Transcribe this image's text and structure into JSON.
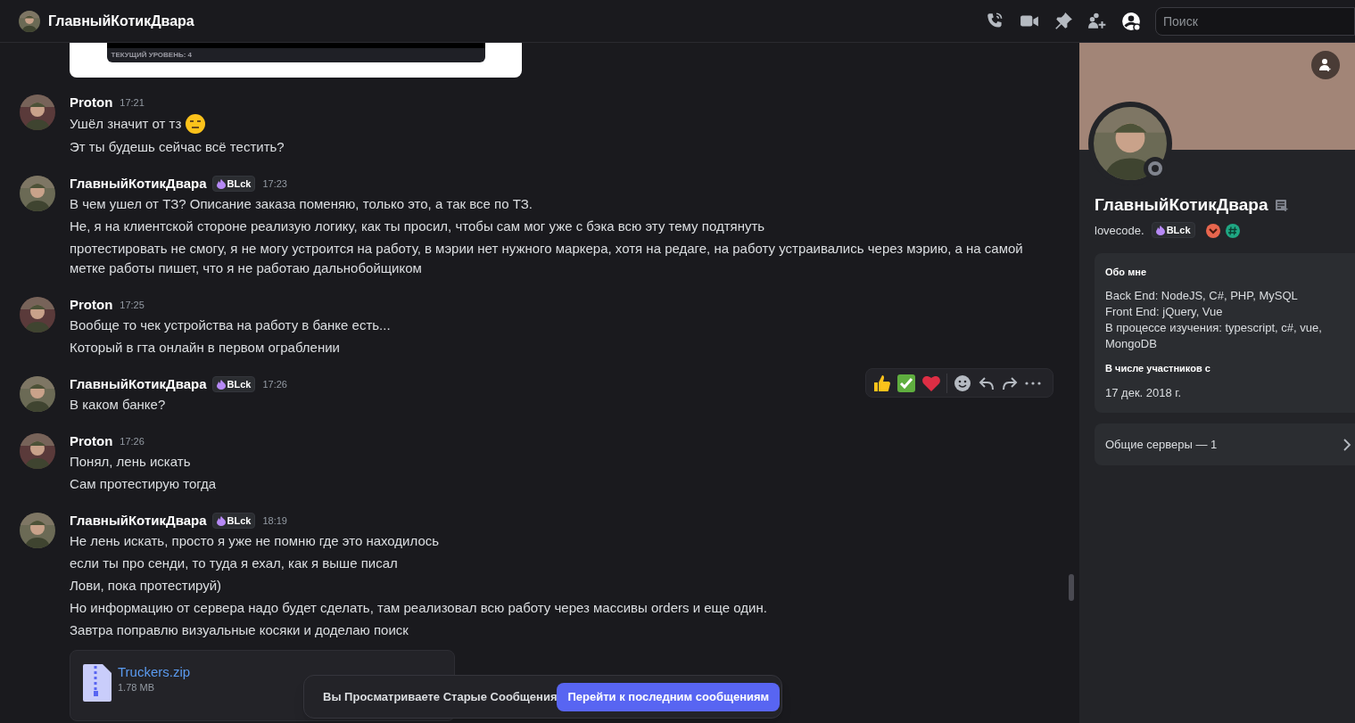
{
  "header": {
    "title": "ГлавныйКотикДвара",
    "toolbar": [
      {
        "kind": "call",
        "selected": false
      },
      {
        "kind": "video",
        "selected": false
      },
      {
        "kind": "pin",
        "selected": false
      },
      {
        "kind": "add_member",
        "selected": false
      },
      {
        "kind": "profile",
        "selected": true
      }
    ],
    "search": {
      "placeholder": "Поиск"
    }
  },
  "embed": {
    "caption": "ТЕКУЩИЙ УРОВЕНЬ: 4"
  },
  "messages": [
    {
      "author": "Proton",
      "time": "17:21",
      "lines": [
        {
          "text": "Ушёл значит от тз",
          "emoji": true
        },
        {
          "text": "Эт ты будешь сейчас всё тестить?",
          "emoji": false
        }
      ]
    },
    {
      "author": "ГлавныйКотикДвара",
      "tag": "BLck",
      "time": "17:23",
      "lines": [
        {
          "text": "В чем ушел от ТЗ? Описание заказа поменяю, только это, а так все по ТЗ.",
          "emoji": false
        },
        {
          "text": "Не, я на клиентской стороне реализую логику, как ты просил, чтобы сам мог уже с бэка всю эту тему подтянуть",
          "emoji": false
        },
        {
          "text": "протестировать не смогу, я не могу устроится на работу, в мэрии нет нужного маркера, хотя на редаге, на работу устраивались через мэрию, а на самой метке работы пишет, что я не работаю дальнобойщиком",
          "emoji": false
        }
      ]
    },
    {
      "author": "Proton",
      "time": "17:25",
      "lines": [
        {
          "text": "Вообще то чек устройства на работу в банке есть...",
          "emoji": false
        },
        {
          "text": "Который в гта онлайн в первом ограблении",
          "emoji": false
        }
      ]
    },
    {
      "author": "ГлавныйКотикДвара",
      "tag": "BLck",
      "time": "17:26",
      "lines": [
        {
          "text": "В каком банке?",
          "emoji": false
        }
      ]
    },
    {
      "author": "Proton",
      "time": "17:26",
      "lines": [
        {
          "text": "Понял, лень искать",
          "emoji": false
        },
        {
          "text": "Сам протестирую тогда",
          "emoji": false
        }
      ]
    },
    {
      "author": "ГлавныйКотикДвара",
      "tag": "BLck",
      "time": "18:19",
      "lines": [
        {
          "text": "Не лень искать, просто я уже не помню где это находилось",
          "emoji": false
        },
        {
          "text": "если ты про сенди, то туда я ехал, как я выше писал",
          "emoji": false
        },
        {
          "text": "Лови, пока протестируй)",
          "emoji": false
        },
        {
          "text": "Но информацию от сервера надо будет сделать, там реализовал всю работу через массивы orders и еще один.",
          "emoji": false
        },
        {
          "text": "Завтра поправлю визуальные косяки и доделаю поиск",
          "emoji": false
        }
      ],
      "attachment": {
        "name": "Truckers.zip",
        "size": "1.78 MB"
      }
    }
  ],
  "notice": {
    "text": "Вы Просматриваете Старые Сообщения",
    "button": "Перейти к последним сообщениям"
  },
  "profile": {
    "name": "ГлавныйКотикДвара",
    "username": "lovecode.",
    "tag": "BLck",
    "about_title": "Обо мне",
    "about": [
      "Back End: NodeJS, C#, PHP, MySQL",
      "Front End: jQuery, Vue",
      "В процессе изучения: typescript, c#, vue, MongoDB"
    ],
    "member_since_title": "В числе участников с",
    "member_since": "17 дек. 2018 г.",
    "mutual_servers": "Общие серверы — 1"
  }
}
